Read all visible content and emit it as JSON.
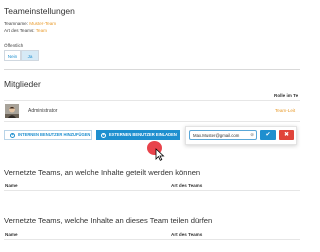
{
  "settings": {
    "title": "Teameinstellungen",
    "name_label": "Teamname:",
    "name_value": "Muster-Team",
    "type_label": "Art des Teams:",
    "type_value": "Team",
    "public_label": "Öffentlich",
    "public_no": "Nein",
    "public_yes": "Ja"
  },
  "members": {
    "title": "Mitglieder",
    "col_role": "Rolle im Te",
    "rows": [
      {
        "name": "Administrator",
        "role": "Team-Leit"
      }
    ],
    "add_internal": "INTERNEN BENUTZER HINZUFÜGEN",
    "invite_external": "EXTERNEN BENUTZER EINLADEN",
    "invite_email": "Max.Muster@gmail.com"
  },
  "shared_with": {
    "title": "Vernetzte Teams, an welche Inhalte geteilt werden können",
    "col_name": "Name",
    "col_type": "Art des Teams"
  },
  "share_from": {
    "title": "Vernetzte Teams, welche Inhalte an dieses Team teilen dürfen",
    "col_name": "Name",
    "col_type": "Art des Teams"
  },
  "colors": {
    "accent": "#1e8fcf",
    "orange": "#e89a2a",
    "danger": "#e0443a"
  }
}
